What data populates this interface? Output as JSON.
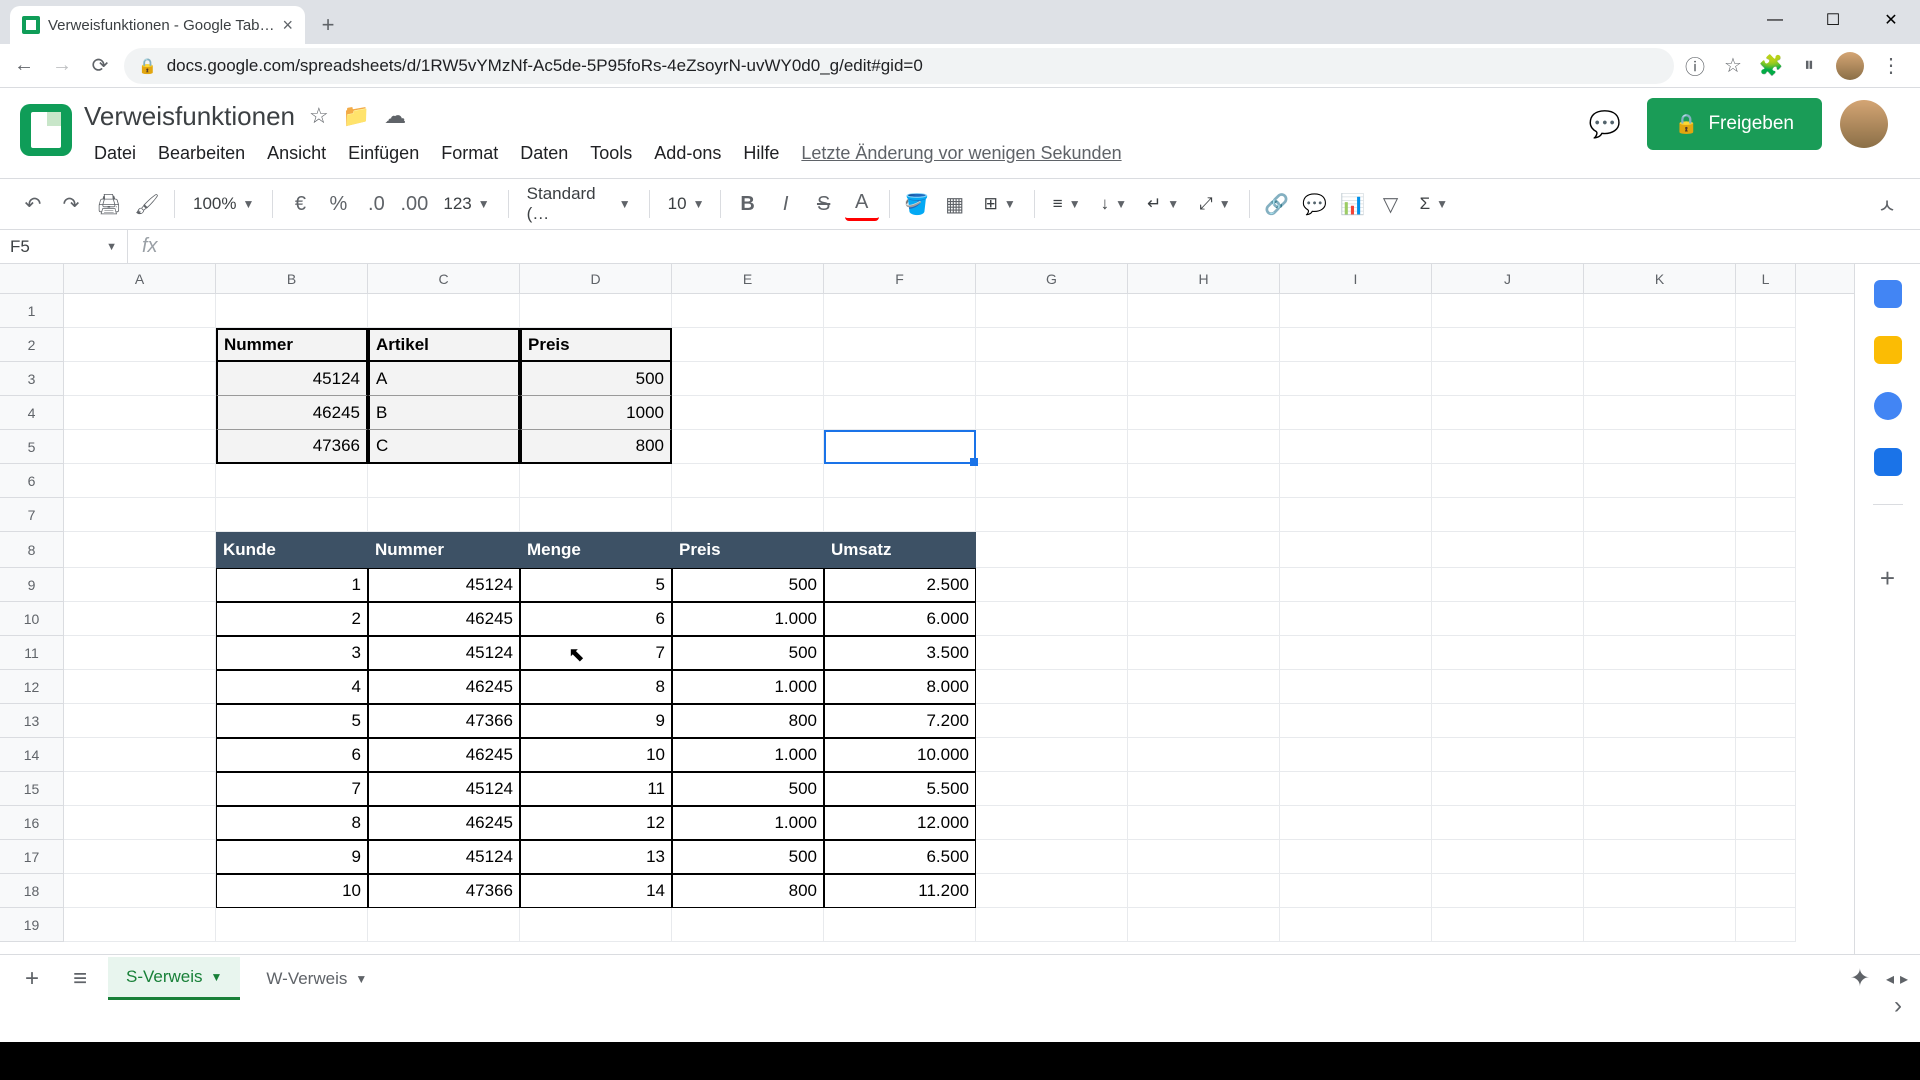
{
  "browser": {
    "tab_title": "Verweisfunktionen - Google Tab…",
    "url": "docs.google.com/spreadsheets/d/1RW5vYMzNf-Ac5de-5P95foRs-4eZsoyrN-uvWY0d0_g/edit#gid=0"
  },
  "app": {
    "doc_title": "Verweisfunktionen",
    "menus": [
      "Datei",
      "Bearbeiten",
      "Ansicht",
      "Einfügen",
      "Format",
      "Daten",
      "Tools",
      "Add-ons",
      "Hilfe"
    ],
    "last_edit": "Letzte Änderung vor wenigen Sekunden",
    "share_label": "Freigeben"
  },
  "toolbar": {
    "zoom": "100%",
    "currency": "€",
    "font": "Standard (…",
    "font_size": "10",
    "format_number": "123"
  },
  "formula": {
    "cell_ref": "F5",
    "value": ""
  },
  "columns": [
    "A",
    "B",
    "C",
    "D",
    "E",
    "F",
    "G",
    "H",
    "I",
    "J",
    "K",
    "L"
  ],
  "rows": [
    "1",
    "2",
    "3",
    "4",
    "5",
    "6",
    "7",
    "8",
    "9",
    "10",
    "11",
    "12",
    "13",
    "14",
    "15",
    "16",
    "17",
    "18",
    "19"
  ],
  "table1": {
    "headers": [
      "Nummer",
      "Artikel",
      "Preis"
    ],
    "rows": [
      {
        "nummer": "45124",
        "artikel": "A",
        "preis": "500"
      },
      {
        "nummer": "46245",
        "artikel": "B",
        "preis": "1000"
      },
      {
        "nummer": "47366",
        "artikel": "C",
        "preis": "800"
      }
    ]
  },
  "table2": {
    "headers": [
      "Kunde",
      "Nummer",
      "Menge",
      "Preis",
      "Umsatz"
    ],
    "rows": [
      {
        "kunde": "1",
        "nummer": "45124",
        "menge": "5",
        "preis": "500",
        "umsatz": "2.500"
      },
      {
        "kunde": "2",
        "nummer": "46245",
        "menge": "6",
        "preis": "1.000",
        "umsatz": "6.000"
      },
      {
        "kunde": "3",
        "nummer": "45124",
        "menge": "7",
        "preis": "500",
        "umsatz": "3.500"
      },
      {
        "kunde": "4",
        "nummer": "46245",
        "menge": "8",
        "preis": "1.000",
        "umsatz": "8.000"
      },
      {
        "kunde": "5",
        "nummer": "47366",
        "menge": "9",
        "preis": "800",
        "umsatz": "7.200"
      },
      {
        "kunde": "6",
        "nummer": "46245",
        "menge": "10",
        "preis": "1.000",
        "umsatz": "10.000"
      },
      {
        "kunde": "7",
        "nummer": "45124",
        "menge": "11",
        "preis": "500",
        "umsatz": "5.500"
      },
      {
        "kunde": "8",
        "nummer": "46245",
        "menge": "12",
        "preis": "1.000",
        "umsatz": "12.000"
      },
      {
        "kunde": "9",
        "nummer": "45124",
        "menge": "13",
        "preis": "500",
        "umsatz": "6.500"
      },
      {
        "kunde": "10",
        "nummer": "47366",
        "menge": "14",
        "preis": "800",
        "umsatz": "11.200"
      }
    ]
  },
  "sheets": {
    "tabs": [
      "S-Verweis",
      "W-Verweis"
    ],
    "active": 0
  },
  "selected_cell": {
    "col": "F",
    "row": 5
  }
}
